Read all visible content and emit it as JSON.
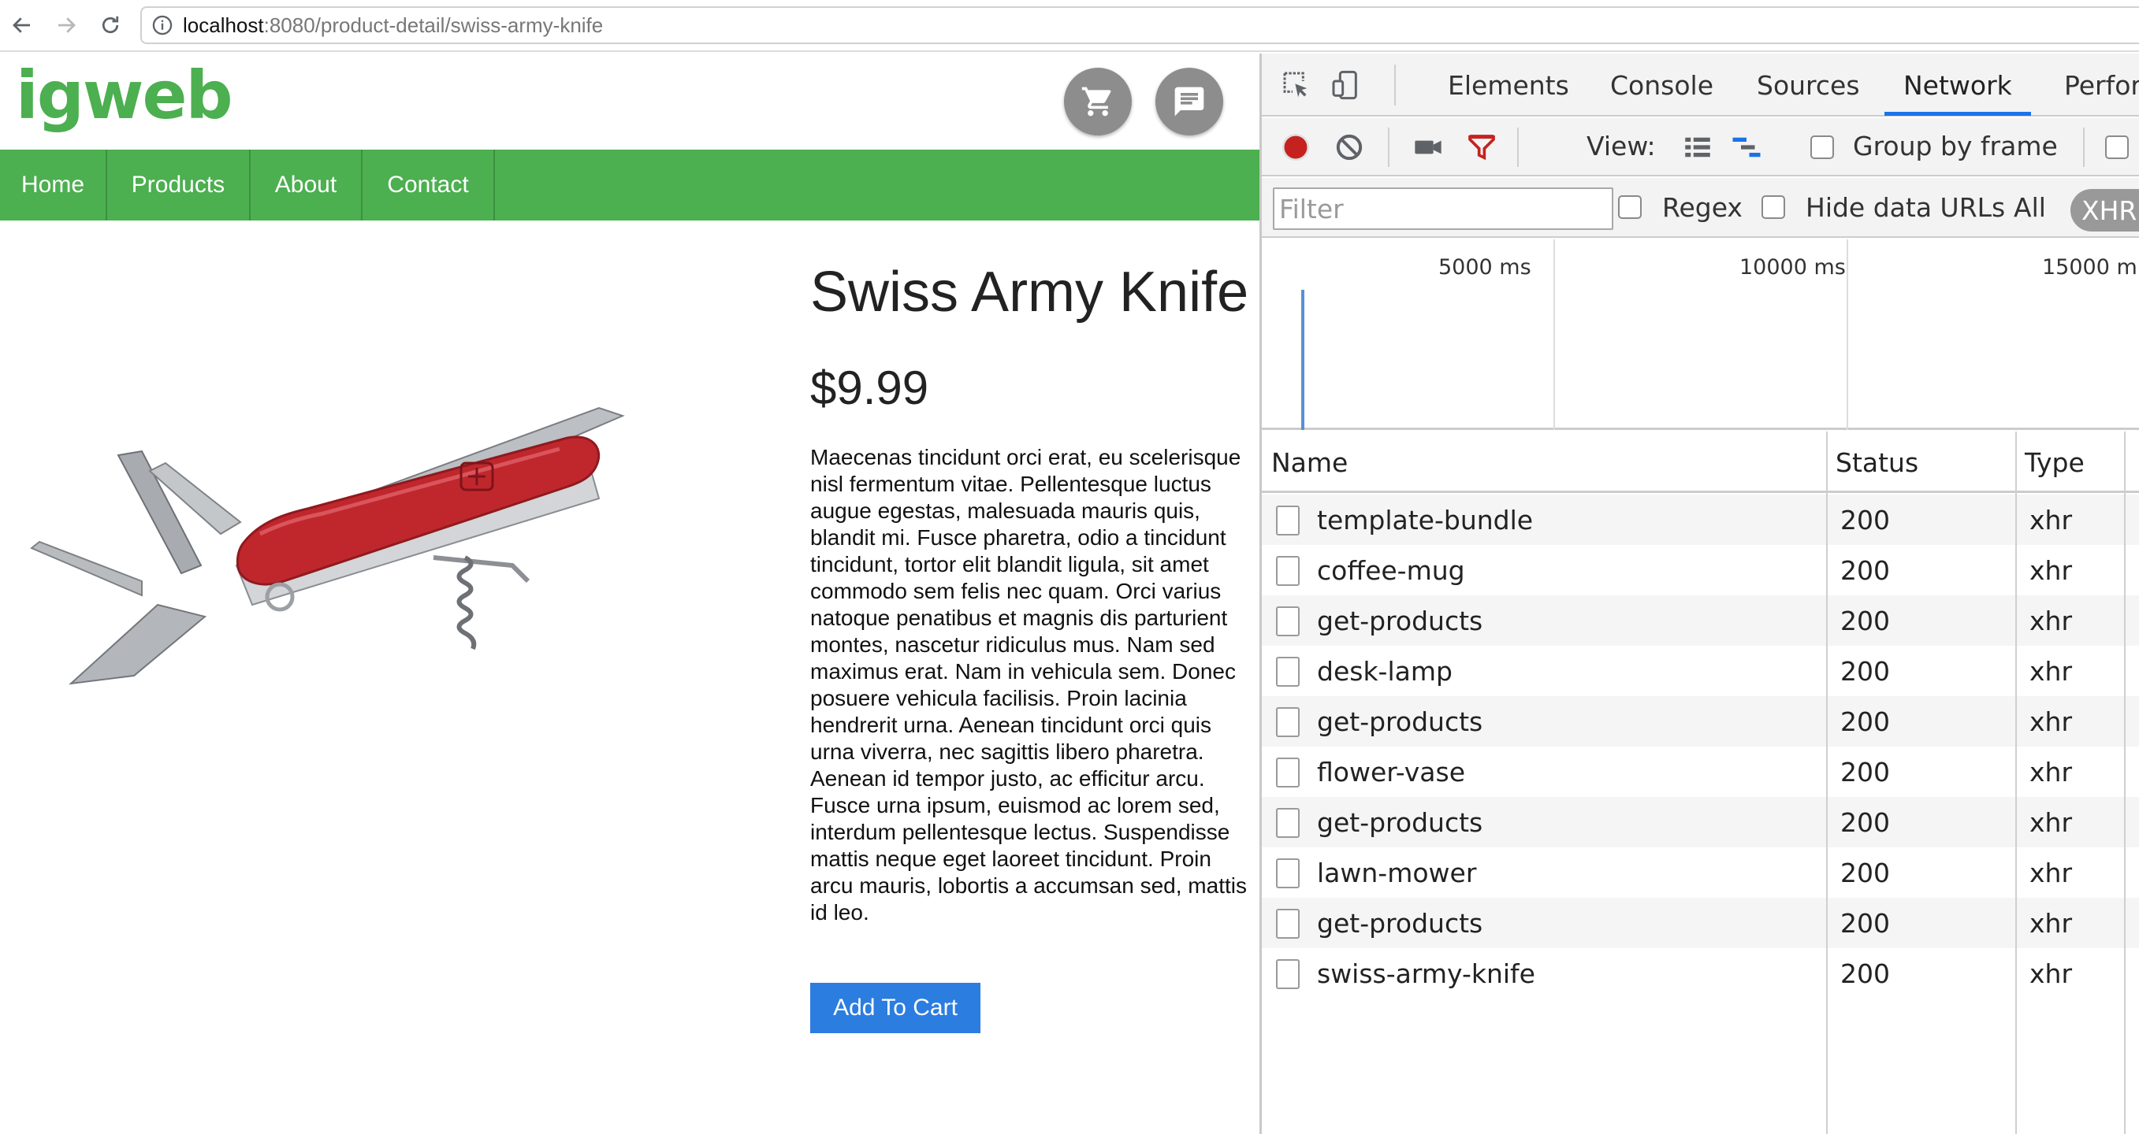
{
  "browser": {
    "url_host": "localhost",
    "url_path": ":8080/product-detail/swiss-army-knife"
  },
  "site": {
    "logo": "igweb",
    "nav": [
      {
        "label": "Home"
      },
      {
        "label": "Products"
      },
      {
        "label": "About"
      },
      {
        "label": "Contact"
      }
    ],
    "brand_color": "#4caf50"
  },
  "product": {
    "title": "Swiss Army Knife",
    "price": "$9.99",
    "description": "Maecenas tincidunt orci erat, eu scelerisque nisl fermentum vitae. Pellentesque luctus augue egestas, malesuada mauris quis, blandit mi. Fusce pharetra, odio a tincidunt tincidunt, tortor elit blandit ligula, sit amet commodo sem felis nec quam. Orci varius natoque penatibus et magnis dis parturient montes, nascetur ridiculus mus. Nam sed maximus erat. Nam in vehicula sem. Donec posuere vehicula facilisis. Proin lacinia hendrerit urna. Aenean tincidunt orci quis urna viverra, nec sagittis libero pharetra. Aenean id tempor justo, ac efficitur arcu. Fusce urna ipsum, euismod ac lorem sed, interdum pellentesque lectus. Suspendisse mattis neque eget laoreet tincidunt. Proin arcu mauris, lobortis a accumsan sed, mattis id leo.",
    "add_to_cart_label": "Add To Cart"
  },
  "devtools": {
    "tabs": [
      {
        "label": "Elements"
      },
      {
        "label": "Console"
      },
      {
        "label": "Sources"
      },
      {
        "label": "Network"
      },
      {
        "label": "Perfor"
      }
    ],
    "active_tab": "Network",
    "toolbar": {
      "view_label": "View:",
      "group_by_frame_label": "Group by frame"
    },
    "filter": {
      "placeholder": "Filter",
      "regex_label": "Regex",
      "hide_data_urls_label": "Hide data URLs",
      "all_label": "All",
      "xhr_label": "XHR"
    },
    "timeline_ticks": [
      "5000 ms",
      "10000 ms",
      "15000 m"
    ],
    "table": {
      "columns": [
        "Name",
        "Status",
        "Type"
      ],
      "rows": [
        {
          "name": "template-bundle",
          "status": "200",
          "type": "xhr"
        },
        {
          "name": "coffee-mug",
          "status": "200",
          "type": "xhr"
        },
        {
          "name": "get-products",
          "status": "200",
          "type": "xhr"
        },
        {
          "name": "desk-lamp",
          "status": "200",
          "type": "xhr"
        },
        {
          "name": "get-products",
          "status": "200",
          "type": "xhr"
        },
        {
          "name": "flower-vase",
          "status": "200",
          "type": "xhr"
        },
        {
          "name": "get-products",
          "status": "200",
          "type": "xhr"
        },
        {
          "name": "lawn-mower",
          "status": "200",
          "type": "xhr"
        },
        {
          "name": "get-products",
          "status": "200",
          "type": "xhr"
        },
        {
          "name": "swiss-army-knife",
          "status": "200",
          "type": "xhr"
        }
      ]
    },
    "accent_color": "#1a73e8",
    "record_color": "#c5221f"
  }
}
